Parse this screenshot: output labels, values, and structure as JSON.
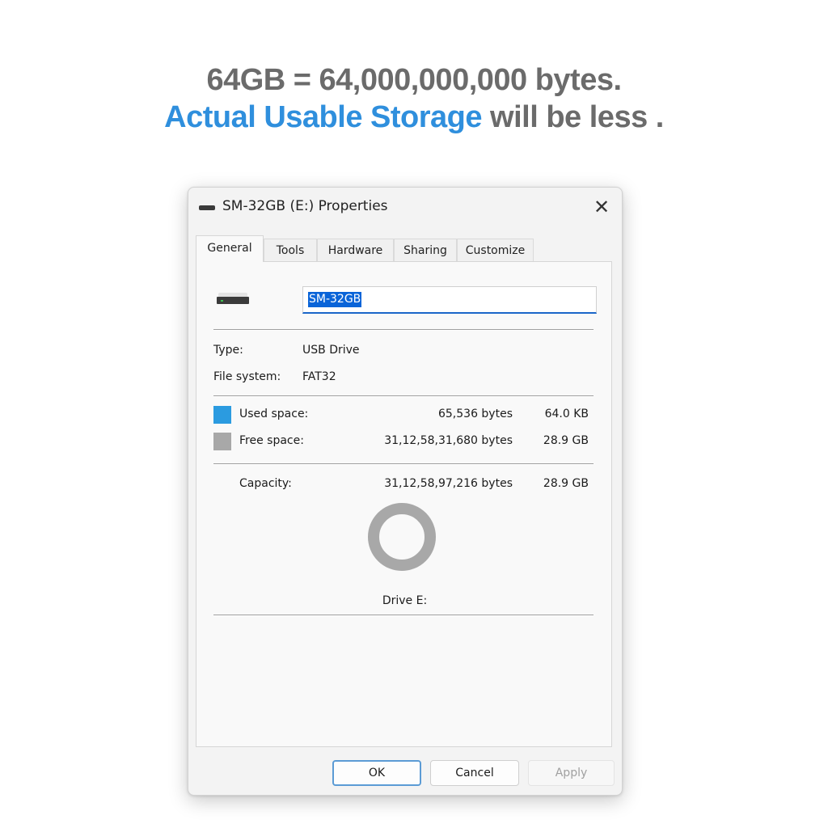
{
  "headline": {
    "line1": "64GB = 64,000,000,000 bytes.",
    "line2_accent": "Actual Usable Storage",
    "line2_rest": " will be less ."
  },
  "dialog": {
    "title": "SM-32GB (E:) Properties",
    "close_icon": "close-icon",
    "tabs": [
      {
        "label": "General",
        "active": true
      },
      {
        "label": "Tools",
        "active": false
      },
      {
        "label": "Hardware",
        "active": false
      },
      {
        "label": "Sharing",
        "active": false
      },
      {
        "label": "Customize",
        "active": false
      }
    ],
    "drive_icon": "usb-drive-icon",
    "name_value": "SM-32GB",
    "type_label": "Type:",
    "type_value": "USB Drive",
    "fs_label": "File system:",
    "fs_value": "FAT32",
    "used": {
      "label": "Used space:",
      "bytes": "65,536 bytes",
      "size": "64.0 KB",
      "color": "#2b9be0"
    },
    "free": {
      "label": "Free space:",
      "bytes": "31,12,58,31,680 bytes",
      "size": "28.9 GB",
      "color": "#a8a8a8"
    },
    "capacity": {
      "label": "Capacity:",
      "bytes": "31,12,58,97,216 bytes",
      "size": "28.9 GB"
    },
    "usage_fraction_used": 2.1e-06,
    "drive_label": "Drive E:",
    "buttons": {
      "ok": "OK",
      "cancel": "Cancel",
      "apply": "Apply",
      "apply_enabled": false
    }
  }
}
